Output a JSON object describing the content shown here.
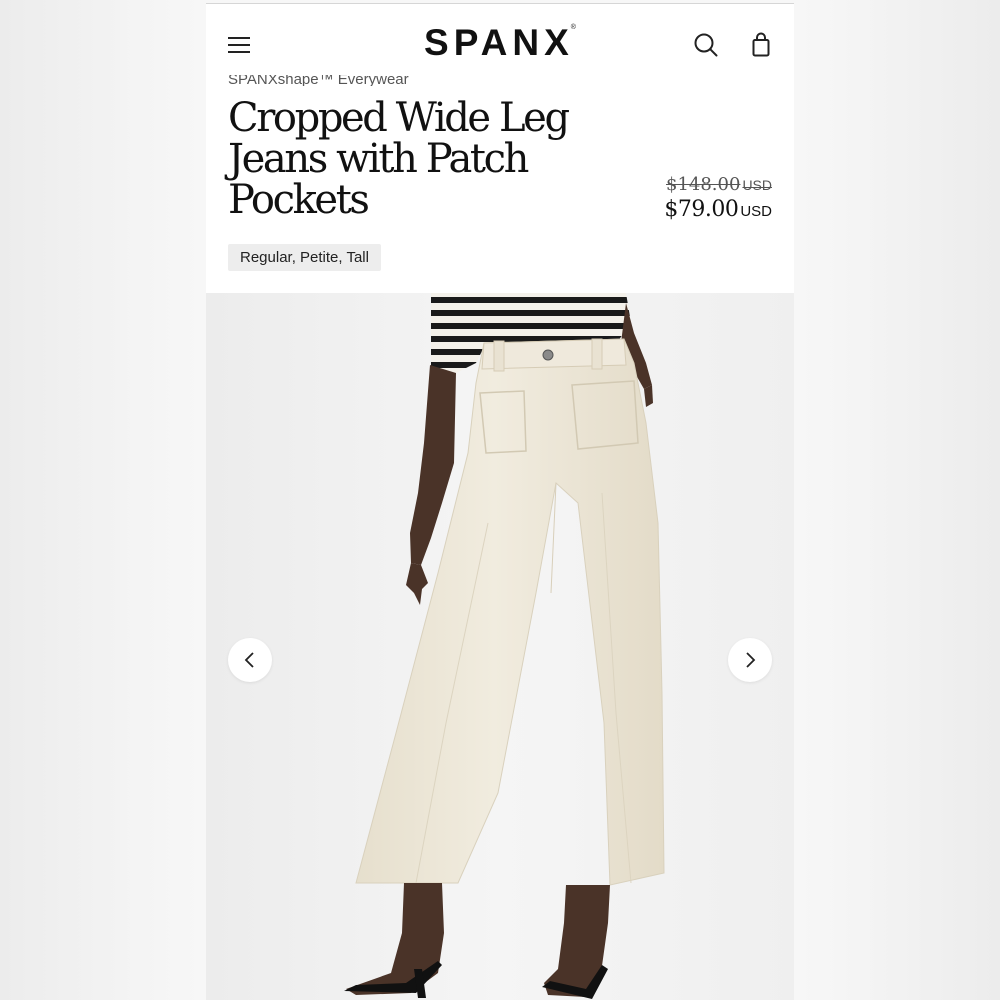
{
  "header": {
    "logo": "SPANX",
    "logo_mark": "®",
    "menu_icon": "hamburger-menu-icon",
    "search_icon": "search-icon",
    "bag_icon": "shopping-bag-icon"
  },
  "product": {
    "breadcrumb": "SPANXshape™ Everywear",
    "title": "Cropped Wide Leg Jeans with Patch Pockets",
    "original_price": "$148.00",
    "original_currency": "USD",
    "sale_price": "$79.00",
    "sale_currency": "USD",
    "sizes_label": "Regular, Petite, Tall"
  },
  "gallery": {
    "prev_icon": "chevron-left-icon",
    "next_icon": "chevron-right-icon",
    "image_subject": "model wearing cream wide leg jeans with striped top"
  },
  "colors": {
    "background": "#f4f4f4",
    "header_bg": "#ffffff",
    "text": "#111111",
    "pill_bg": "#ededed",
    "jeans": "#ece6d6"
  }
}
